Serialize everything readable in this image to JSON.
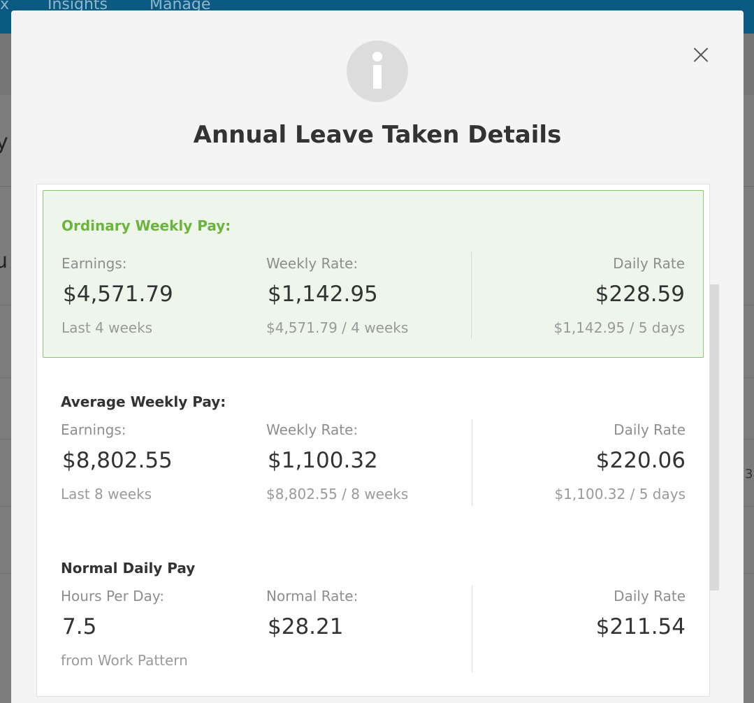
{
  "background": {
    "nav_items": [
      "x",
      "Insights",
      "Manage"
    ],
    "fragments": [
      "y",
      "u",
      "3"
    ]
  },
  "modal": {
    "title": "Annual Leave Taken Details",
    "sections": {
      "ordinary": {
        "title": "Ordinary Weekly Pay:",
        "earnings_label": "Earnings:",
        "earnings_value": "$4,571.79",
        "earnings_sub": "Last 4 weeks",
        "weekly_label": "Weekly Rate:",
        "weekly_value": "$1,142.95",
        "weekly_sub": "$4,571.79 / 4 weeks",
        "daily_label": "Daily Rate",
        "daily_value": "$228.59",
        "daily_sub": "$1,142.95 / 5 days"
      },
      "average": {
        "title": "Average Weekly Pay:",
        "earnings_label": "Earnings:",
        "earnings_value": "$8,802.55",
        "earnings_sub": "Last 8 weeks",
        "weekly_label": "Weekly Rate:",
        "weekly_value": "$1,100.32",
        "weekly_sub": "$8,802.55 / 8 weeks",
        "daily_label": "Daily Rate",
        "daily_value": "$220.06",
        "daily_sub": "$1,100.32 / 5 days"
      },
      "normal": {
        "title": "Normal Daily Pay",
        "hours_label": "Hours Per Day:",
        "hours_value": "7.5",
        "hours_sub": "from Work Pattern",
        "rate_label": "Normal Rate:",
        "rate_value": "$28.21",
        "daily_label": "Daily Rate",
        "daily_value": "$211.54"
      }
    }
  },
  "colors": {
    "accent_green": "#6cb33f",
    "highlight_bg": "#eef5ea",
    "topbar": "#0a5a83"
  },
  "icons": [
    "info-icon",
    "close-icon"
  ]
}
